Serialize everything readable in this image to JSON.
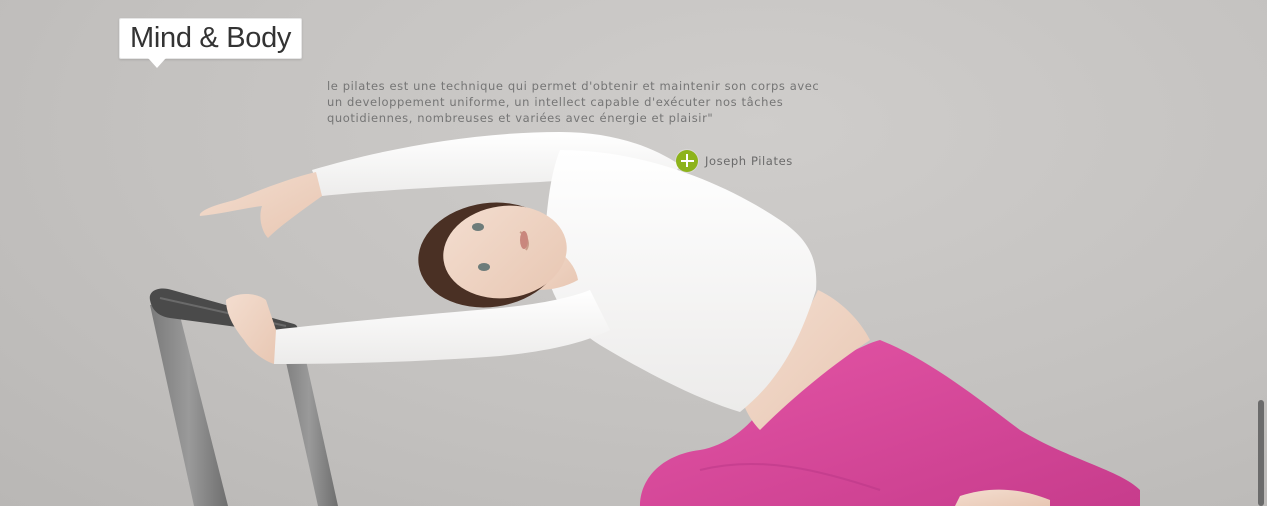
{
  "header": {
    "title": "Mind & Body"
  },
  "quote": {
    "lines": [
      "le pilates est une technique qui permet d'obtenir et maintenir son corps avec",
      "un developpement uniforme, un intellect capable d'exécuter nos tâches",
      "quotidiennes, nombreuses et variées avec énergie et plaisir\""
    ]
  },
  "author": {
    "name": "Joseph Pilates",
    "icon": "plus-circle-icon",
    "icon_color": "#8db31b"
  },
  "hero": {
    "background_color": "#c7c5c3",
    "shirt_color": "#ffffff",
    "pants_color": "#d9489b"
  }
}
